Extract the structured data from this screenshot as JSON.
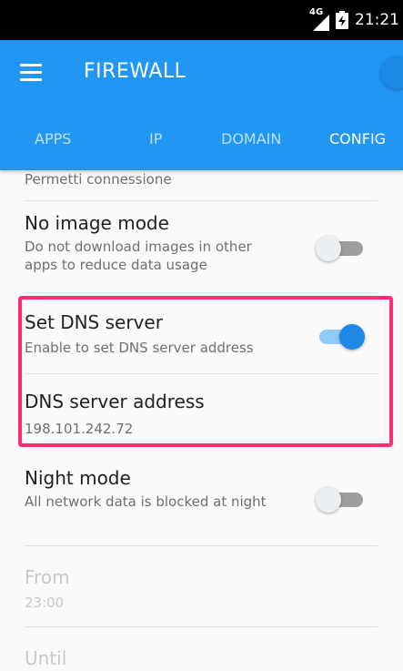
{
  "status_bar": {
    "network": "4G",
    "time": "21:21"
  },
  "toolbar": {
    "title": "FIREWALL"
  },
  "tabs": [
    {
      "label": "APPS",
      "active": false
    },
    {
      "label": "IP",
      "active": false
    },
    {
      "label": "DOMAIN",
      "active": false
    },
    {
      "label": "CONFIG",
      "active": true
    }
  ],
  "settings": {
    "allow_connection": {
      "summary": "Permetti connessione"
    },
    "no_image_mode": {
      "title": "No image mode",
      "summary": "Do not download images in other apps to reduce data usage",
      "enabled": false
    },
    "set_dns_server": {
      "title": "Set DNS server",
      "summary": "Enable to set DNS server address",
      "enabled": true
    },
    "dns_server_address": {
      "title": "DNS server address",
      "value": "198.101.242.72"
    },
    "night_mode": {
      "title": "Night mode",
      "summary": "All network data is blocked at night",
      "enabled": false
    },
    "from": {
      "title": "From",
      "value": "23:00"
    },
    "until": {
      "title": "Until"
    }
  },
  "colors": {
    "primary": "#2196F3",
    "accent": "#1E88E5",
    "highlight": "#FF2D6E"
  }
}
